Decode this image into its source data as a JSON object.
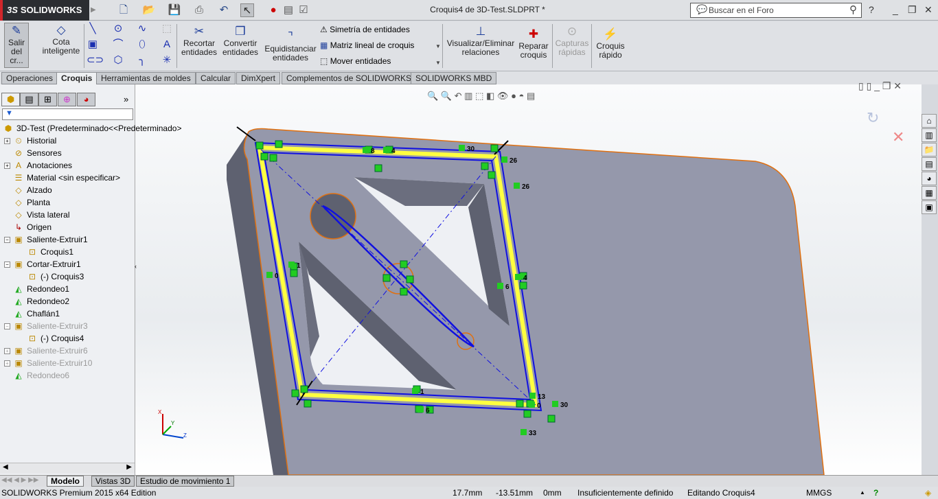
{
  "app": {
    "logo": "SOLIDWORKS",
    "title": "Croquis4 de 3D-Test.SLDPRT *"
  },
  "search": {
    "placeholder": "Buscar en el Foro"
  },
  "ribbon": {
    "exit_sketch": "Salir del cr...",
    "smart_dim": "Cota inteligente",
    "trim": "Recortar entidades",
    "convert": "Convertir entidades",
    "offset": "Equidistanciar entidades",
    "mirror": "Simetría de entidades",
    "linear_pattern": "Matriz lineal de croquis",
    "move": "Mover entidades",
    "relations": "Visualizar/Eliminar relaciones",
    "repair": "Reparar croquis",
    "snaps": "Capturas rápidas",
    "rapid": "Croquis rápido"
  },
  "tabs": [
    "Operaciones",
    "Croquis",
    "Herramientas de moldes",
    "Calcular",
    "DimXpert",
    "Complementos de SOLIDWORKS",
    "SOLIDWORKS MBD"
  ],
  "active_tab": "Croquis",
  "tree": {
    "root": "3D-Test  (Predeterminado<<Predeterminado>",
    "items": [
      {
        "label": "Historial",
        "icon": "history-icon"
      },
      {
        "label": "Sensores",
        "icon": "sensor-icon"
      },
      {
        "label": "Anotaciones",
        "icon": "annotations-icon"
      },
      {
        "label": "Material <sin especificar>",
        "icon": "material-icon"
      },
      {
        "label": "Alzado",
        "icon": "plane-icon"
      },
      {
        "label": "Planta",
        "icon": "plane-icon"
      },
      {
        "label": "Vista lateral",
        "icon": "plane-icon"
      },
      {
        "label": "Origen",
        "icon": "origin-icon"
      },
      {
        "label": "Saliente-Extruir1",
        "icon": "extrude-icon"
      },
      {
        "label": "Croquis1",
        "icon": "sketch-icon"
      },
      {
        "label": "Cortar-Extruir1",
        "icon": "cut-icon"
      },
      {
        "label": "(-) Croquis3",
        "icon": "sketch-icon"
      },
      {
        "label": "Redondeo1",
        "icon": "fillet-icon"
      },
      {
        "label": "Redondeo2",
        "icon": "fillet-icon"
      },
      {
        "label": "Chaflán1",
        "icon": "chamfer-icon"
      },
      {
        "label": "Saliente-Extruir3",
        "icon": "extrude-icon"
      },
      {
        "label": "(-) Croquis4",
        "icon": "sketch-icon"
      },
      {
        "label": "Saliente-Extruir6",
        "icon": "extrude-icon"
      },
      {
        "label": "Saliente-Extruir10",
        "icon": "extrude-icon"
      },
      {
        "label": "Redondeo6",
        "icon": "fillet-icon"
      }
    ]
  },
  "viewport": {
    "relation_labels": [
      "30",
      "26",
      "26",
      "4",
      "6",
      "0",
      "1",
      "1",
      "30",
      "33",
      "6",
      "4",
      "8",
      "13",
      "0"
    ]
  },
  "bottom_tabs": [
    "Modelo",
    "Vistas 3D",
    "Estudio de movimiento 1"
  ],
  "status": {
    "edition": "SOLIDWORKS Premium 2015 x64 Edition",
    "x": "17.7mm",
    "y": "-13.51mm",
    "z": "0mm",
    "state": "Insuficientemente definido",
    "editing": "Editando Croquis4",
    "units": "MMGS"
  },
  "colors": {
    "sketch": "#1010e0",
    "construction": "#ffff40",
    "part": "#9598a8",
    "edge": "#e07010",
    "relation": "#22cc22"
  }
}
